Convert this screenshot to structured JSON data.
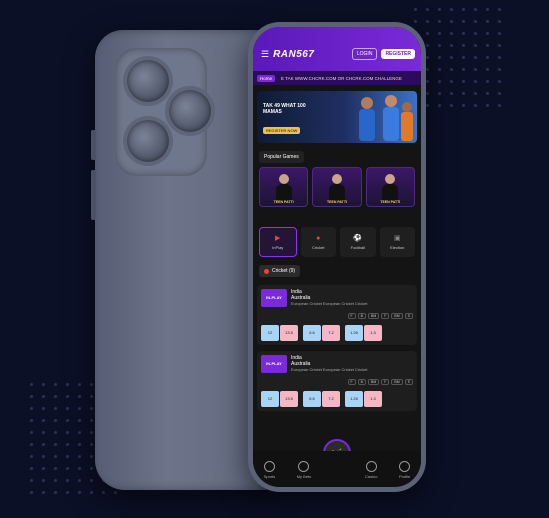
{
  "app": {
    "logo": "RAN567",
    "login_label": "LOGIN",
    "register_label": "REGISTER"
  },
  "ticker": {
    "home_label": "Home",
    "text": "E TAK WWW.CHCRK.COM OR CHCRK.COM CHALLENGE"
  },
  "banner": {
    "headline": "TAK 49 WHAT 100 MAMAS",
    "cta": "REGISTER NOW"
  },
  "popular": {
    "label": "Popular Games",
    "games": [
      "TEEN PATTI",
      "TEEN PATTI",
      "TEEN PATTI"
    ]
  },
  "sports_tabs": [
    {
      "label": "InPlay",
      "icon": "inplay-icon"
    },
    {
      "label": "Cricket",
      "icon": "cricket-icon"
    },
    {
      "label": "Football",
      "icon": "football-icon"
    },
    {
      "label": "Election",
      "icon": "election-icon"
    }
  ],
  "cricket_chip": "Cricket (9)",
  "matches": [
    {
      "inplay": "IN-PLAY",
      "team1": "India",
      "team2": "Australia",
      "league": "European Cricket European Cricket Cricket",
      "badges": [
        "F",
        "B",
        "BM",
        "F",
        "BM",
        "S"
      ],
      "odds": [
        [
          "12",
          "13.5"
        ],
        [
          "6.6",
          "7.2"
        ],
        [
          "1.26",
          "1.3"
        ]
      ]
    },
    {
      "inplay": "IN-PLAY",
      "team1": "India",
      "team2": "Australia",
      "league": "European Cricket European Cricket Cricket",
      "badges": [
        "F",
        "B",
        "BM",
        "F",
        "BM",
        "S"
      ],
      "odds": [
        [
          "12",
          "13.5"
        ],
        [
          "6.6",
          "7.2"
        ],
        [
          "1.26",
          "1.3"
        ]
      ]
    }
  ],
  "bottom_nav": [
    "Sports",
    "My Bets",
    "Casino",
    "Profile"
  ],
  "colors": {
    "background": "#0b1027",
    "brand_purple": "#7a2ad8",
    "back_odd": "#a8d4f5",
    "lay_odd": "#f5b6c6"
  }
}
